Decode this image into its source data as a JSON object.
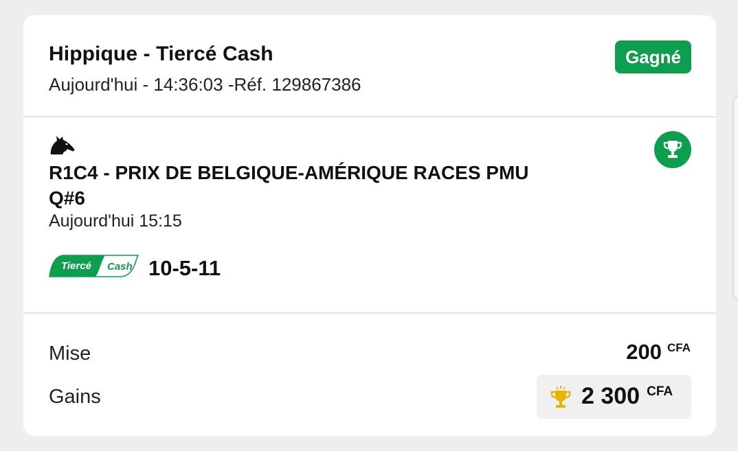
{
  "colors": {
    "accent": "#0f9d4f",
    "gold": "#e8b400",
    "background": "#eeeeee"
  },
  "header": {
    "title": "Hippique - Tiercé Cash",
    "subtitle": "Aujourd'hui - 14:36:03 -Réf. 129867386",
    "status": "Gagné"
  },
  "race": {
    "sport_icon": "horse-icon",
    "status_icon": "trophy-icon",
    "name": "R1C4 -  PRIX DE BELGIQUE-AMÉRIQUE RACES PMU Q#6",
    "time": "Aujourd'hui 15:15",
    "bet_type_logo": {
      "word1": "Tiercé",
      "word2": "Cash"
    },
    "selection": "10-5-11"
  },
  "totals": {
    "stake_label": "Mise",
    "stake_amount": "200",
    "stake_currency": "CFA",
    "winnings_label": "Gains",
    "winnings_icon": "trophy-icon",
    "winnings_amount": "2 300",
    "winnings_currency": "CFA"
  }
}
